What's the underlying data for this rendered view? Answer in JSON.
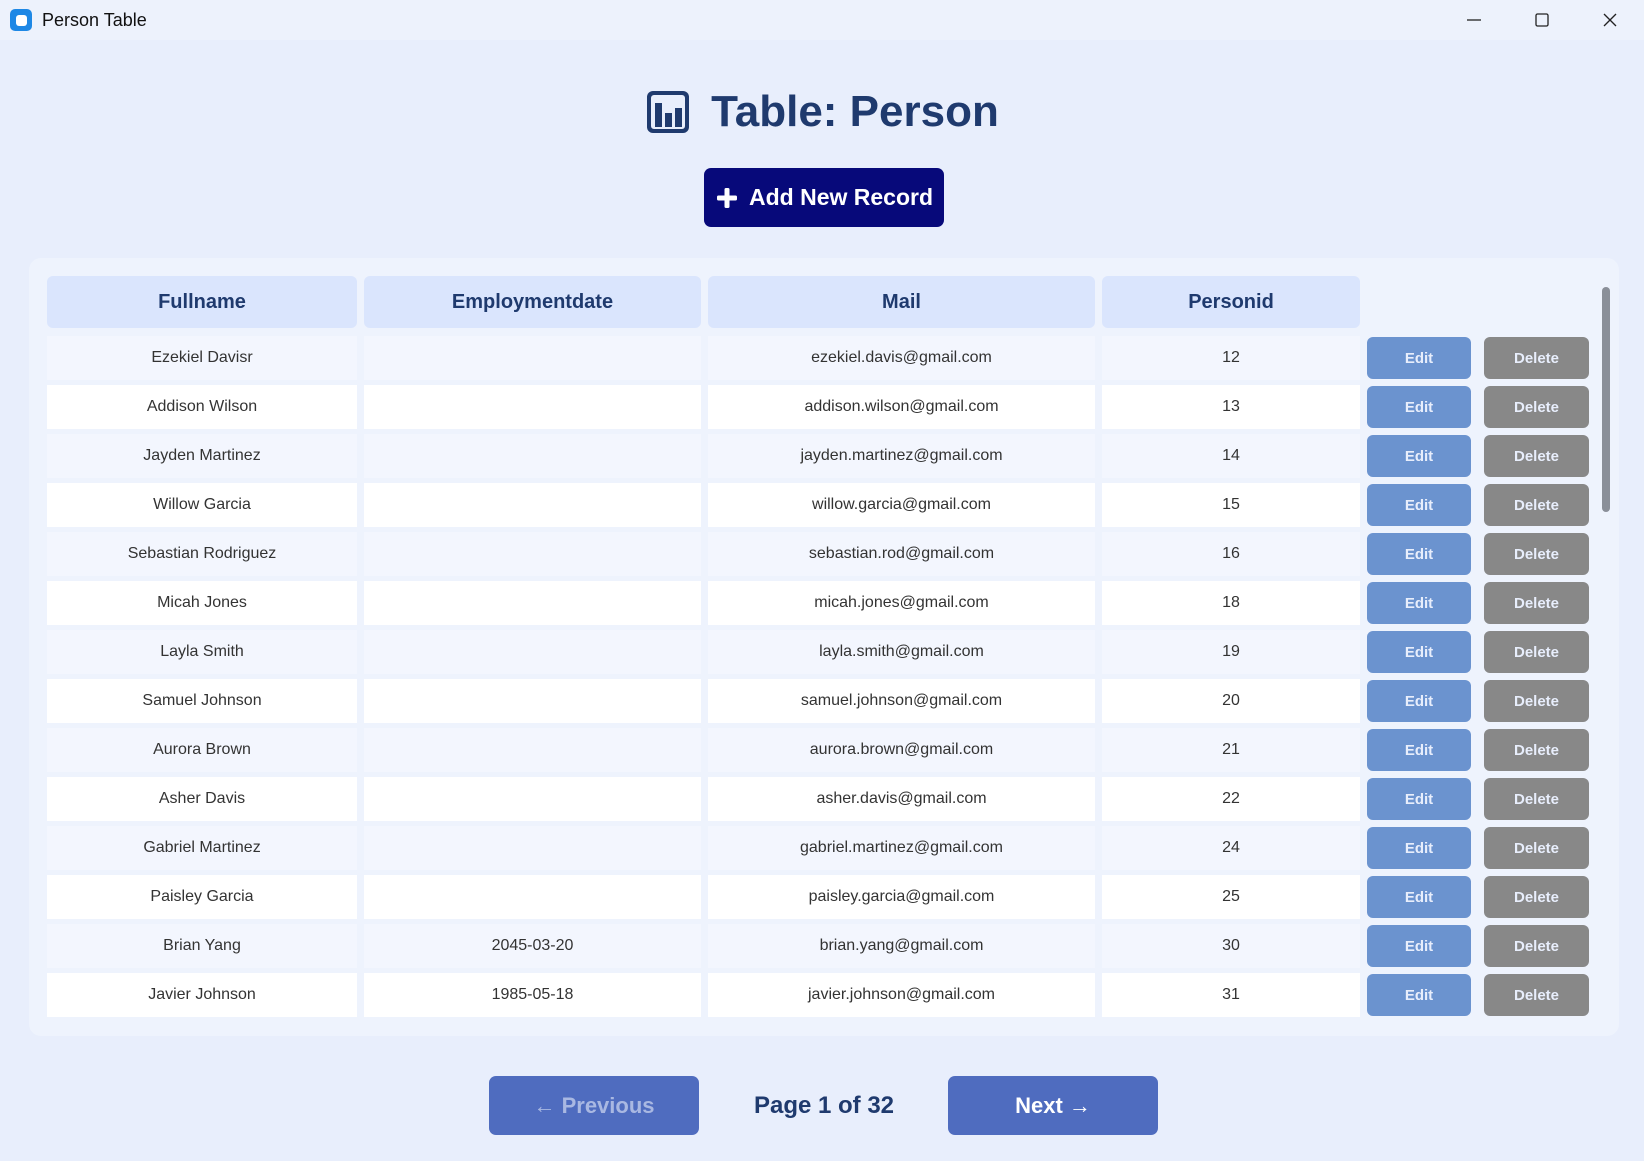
{
  "window": {
    "title": "Person Table"
  },
  "heading": {
    "title": "Table: Person"
  },
  "actions": {
    "add_label": "Add New Record"
  },
  "table": {
    "columns": [
      "Fullname",
      "Employmentdate",
      "Mail",
      "Personid"
    ],
    "edit_label": "Edit",
    "delete_label": "Delete",
    "rows": [
      {
        "fullname": "Ezekiel Davisr",
        "employmentdate": "",
        "mail": "ezekiel.davis@gmail.com",
        "personid": "12"
      },
      {
        "fullname": "Addison Wilson",
        "employmentdate": "",
        "mail": "addison.wilson@gmail.com",
        "personid": "13"
      },
      {
        "fullname": "Jayden Martinez",
        "employmentdate": "",
        "mail": "jayden.martinez@gmail.com",
        "personid": "14"
      },
      {
        "fullname": "Willow Garcia",
        "employmentdate": "",
        "mail": "willow.garcia@gmail.com",
        "personid": "15"
      },
      {
        "fullname": "Sebastian Rodriguez",
        "employmentdate": "",
        "mail": "sebastian.rod@gmail.com",
        "personid": "16"
      },
      {
        "fullname": "Micah Jones",
        "employmentdate": "",
        "mail": "micah.jones@gmail.com",
        "personid": "18"
      },
      {
        "fullname": "Layla Smith",
        "employmentdate": "",
        "mail": "layla.smith@gmail.com",
        "personid": "19"
      },
      {
        "fullname": "Samuel Johnson",
        "employmentdate": "",
        "mail": "samuel.johnson@gmail.com",
        "personid": "20"
      },
      {
        "fullname": "Aurora Brown",
        "employmentdate": "",
        "mail": "aurora.brown@gmail.com",
        "personid": "21"
      },
      {
        "fullname": "Asher Davis",
        "employmentdate": "",
        "mail": "asher.davis@gmail.com",
        "personid": "22"
      },
      {
        "fullname": "Gabriel Martinez",
        "employmentdate": "",
        "mail": "gabriel.martinez@gmail.com",
        "personid": "24"
      },
      {
        "fullname": "Paisley Garcia",
        "employmentdate": "",
        "mail": "paisley.garcia@gmail.com",
        "personid": "25"
      },
      {
        "fullname": "Brian Yang",
        "employmentdate": "2045-03-20",
        "mail": "brian.yang@gmail.com",
        "personid": "30"
      },
      {
        "fullname": "Javier Johnson",
        "employmentdate": "1985-05-18",
        "mail": "javier.johnson@gmail.com",
        "personid": "31"
      }
    ]
  },
  "pagination": {
    "prev_label": "← Previous",
    "next_label": "Next →",
    "page_info": "Page 1 of 32"
  },
  "colors": {
    "primary_button": "#07097a",
    "edit_button": "#6b93cf",
    "delete_button": "#888888",
    "pager_button": "#4f6cbf",
    "heading_text": "#1f3a6e"
  }
}
